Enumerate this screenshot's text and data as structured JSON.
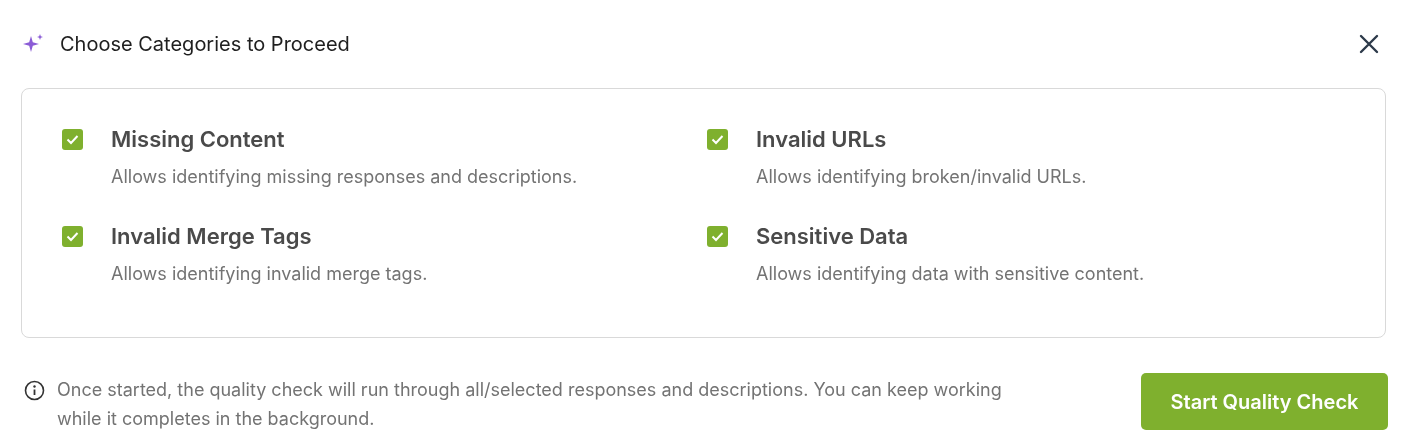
{
  "dialog": {
    "title": "Choose Categories to Proceed"
  },
  "categories": [
    {
      "title": "Missing Content",
      "description": "Allows identifying missing responses and descriptions.",
      "checked": true
    },
    {
      "title": "Invalid URLs",
      "description": "Allows identifying broken/invalid URLs.",
      "checked": true
    },
    {
      "title": "Invalid Merge Tags",
      "description": "Allows identifying invalid merge tags.",
      "checked": true
    },
    {
      "title": "Sensitive Data",
      "description": "Allows identifying data with sensitive content.",
      "checked": true
    }
  ],
  "note": "Once started, the quality check will run through all/selected responses and descriptions. You can keep working while it completes in the background.",
  "buttons": [
    {
      "label": "Start Quality Check"
    }
  ]
}
